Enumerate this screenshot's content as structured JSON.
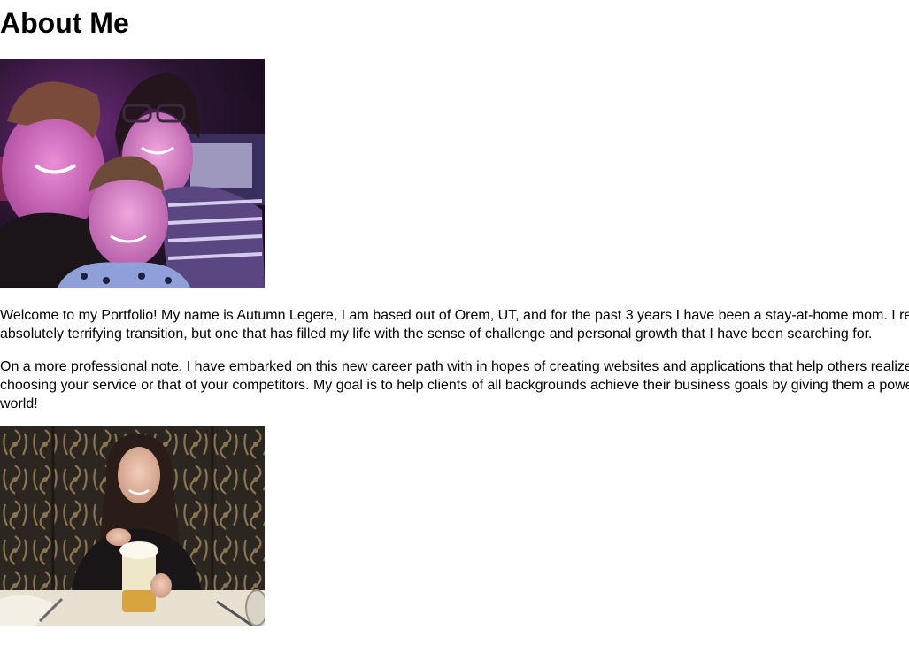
{
  "page": {
    "heading": "About Me",
    "images": {
      "family": {
        "alt": "Family photo"
      },
      "portrait": {
        "alt": "Portrait photo"
      }
    },
    "paragraphs": [
      {
        "lines": [
          "Welcome to my Portfolio! My name is Autumn Legere, I am based out of Orem, UT, and for the past 3 years I have been a stay-at-home mom. I rec",
          "absolutely terrifying transition, but one that has filled my life with the sense of challenge and personal growth that I have been searching for."
        ]
      },
      {
        "lines": [
          "On a more professional note, I have embarked on this new career path with in hopes of creating websites and applications that help others realize",
          "choosing your service or that of your competitors. My goal is to help clients of all backgrounds achieve their business goals by giving them a powe",
          "world!"
        ]
      }
    ]
  }
}
